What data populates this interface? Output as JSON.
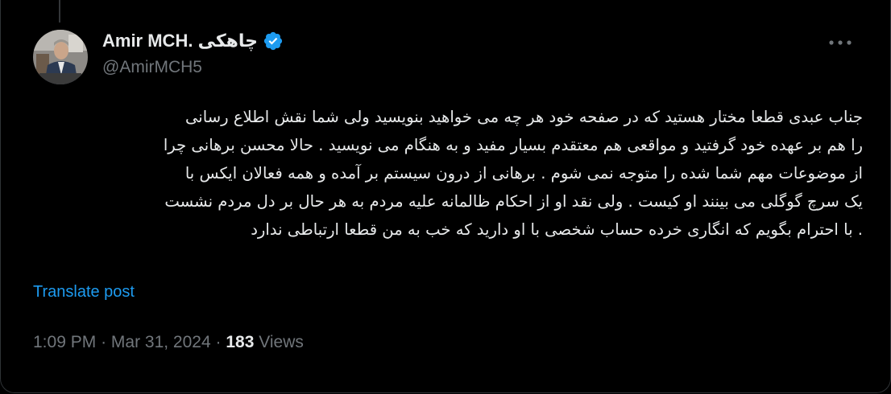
{
  "tweet": {
    "author": {
      "display_name": "Amir MCH. چاهکی",
      "handle": "@AmirMCH5",
      "verified": true,
      "verified_icon": "verified-badge-icon",
      "avatar": "author-avatar"
    },
    "more_icon": "more-horizontal-icon",
    "text_lines": [
      "جناب عبدی قطعا مختار هستید که در صفحه خود هر چه می خواهید بنویسید ولی شما نقش اطلاع رسانی",
      "را هم بر عهده خود گرفتید و مواقعی هم معتقدم بسیار مفید و به هنگام می نویسید . حالا محسن برهانی چرا",
      "از موضوعات مهم شما شده را متوجه نمی شوم . برهانی از درون سیستم بر آمده و همه فعالان ایکس با",
      "یک سرچ گوگلی می بینند او کیست . ولی نقد او از احکام ظالمانه علیه مردم به هر حال بر دل مردم نشست",
      ". با احترام بگویم که انگاری خرده حساب شخصی با او دارید که خب به من قطعا ارتباطی ندارد"
    ],
    "translate_label": "Translate post",
    "time": "1:09 PM",
    "separator": "·",
    "date": "Mar 31, 2024",
    "views_count": "183",
    "views_label": "Views"
  },
  "colors": {
    "background": "#000000",
    "text_primary": "#e7e9ea",
    "text_secondary": "#71767b",
    "accent": "#1d9bf0",
    "border": "#2f3336"
  }
}
